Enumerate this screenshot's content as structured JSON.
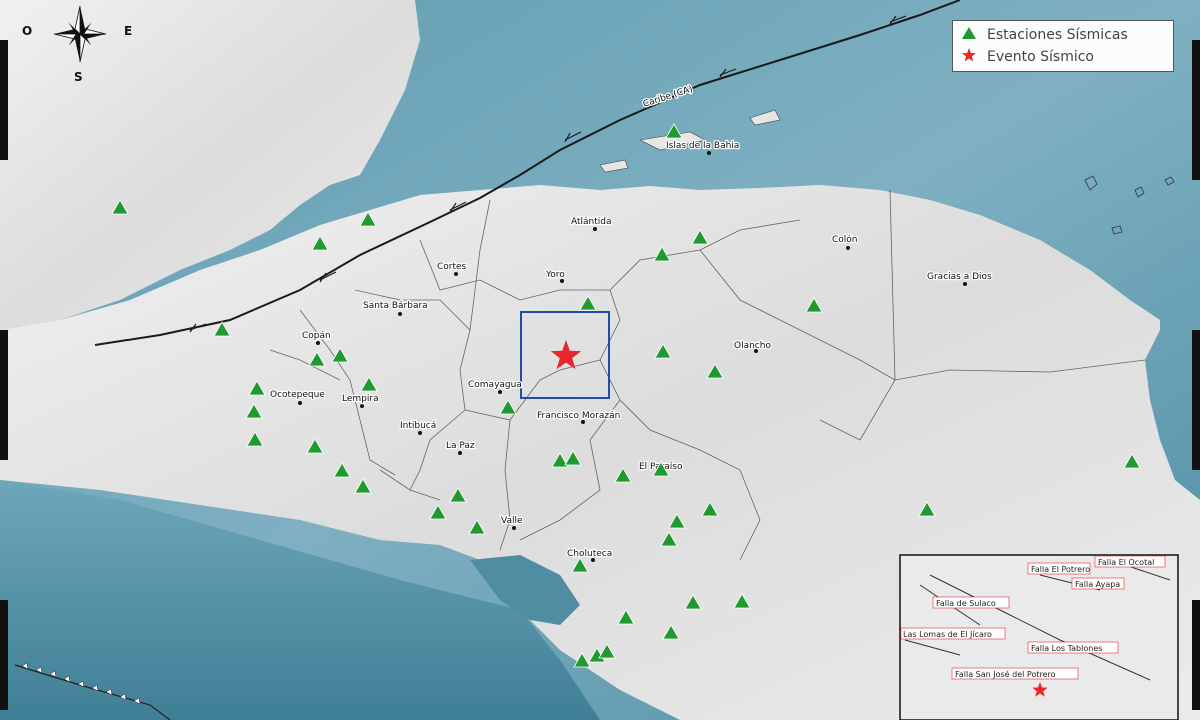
{
  "legend": {
    "stations_label": "Estaciones Sísmicas",
    "event_label": "Evento Sísmico",
    "station_color": "#1f9a2e",
    "event_color": "#e8262c"
  },
  "compass": {
    "west": "O",
    "east": "E",
    "south": "S"
  },
  "fault_label": "Caribe (CA)",
  "places": {
    "islas": "Islas de la Bahia",
    "atlantida": "Atlántida",
    "colon": "Colón",
    "gracias": "Gracias a Dios",
    "cortes": "Cortes",
    "yoro": "Yoro",
    "santa_barbara": "Santa Bárbara",
    "copan": "Copán",
    "olancho": "Olancho",
    "ocotepeque": "Ocotepeque",
    "lempira": "Lempira",
    "comayagua": "Comayagua",
    "francisco_morazan": "Francisco Morazán",
    "intibuca": "Intibucá",
    "la_paz": "La Paz",
    "el_paraiso": "El Paraíso",
    "valle": "Valle",
    "choluteca": "Choluteca"
  },
  "inset_faults": {
    "el_ocotal": "Falla El Ocotal",
    "el_potrero": "Falla El Potrero",
    "ayapa": "Falla Ayapa",
    "sulaco": "Falla de Sulaco",
    "lomas": "Las Lomas de El Jícaro",
    "tablones": "Falla Los Tablones",
    "san_jose": "Falla San José del Potrero"
  },
  "icons": {
    "station": "triangle-icon",
    "event": "star-icon",
    "compass": "compass-rose-icon"
  }
}
